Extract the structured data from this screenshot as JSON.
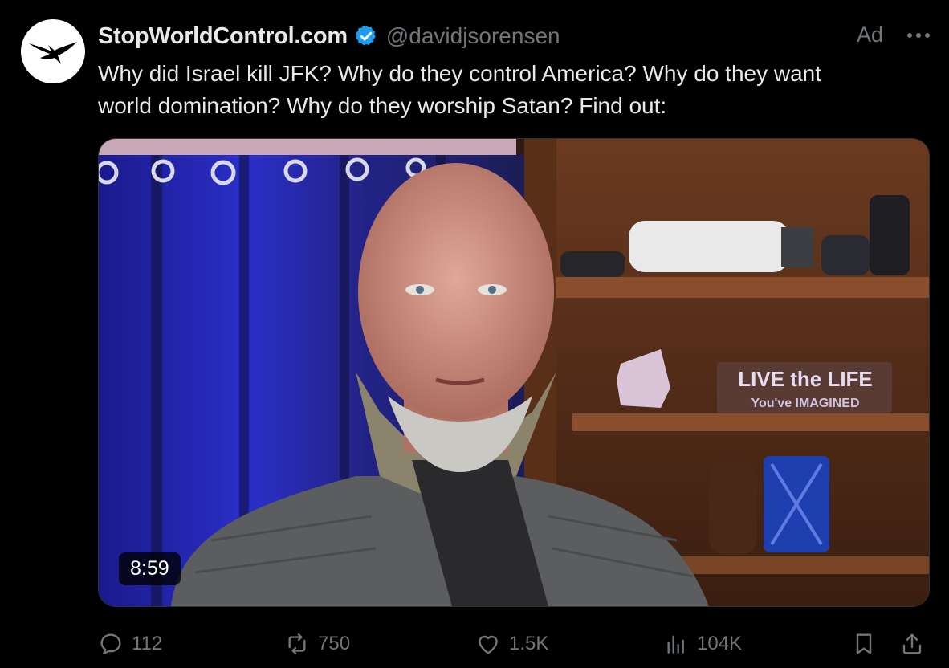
{
  "tweet": {
    "display_name": "StopWorldControl.com",
    "handle": "@davidjsorensen",
    "ad_label": "Ad",
    "text_line1": "Why did Israel kill JFK? Why do they control America? Why do they want",
    "text_line2": "world domination? Why do they worship Satan? Find out:",
    "verified_icon": "verified-badge-icon",
    "more_icon": "more-dots-icon"
  },
  "media": {
    "duration": "8:59",
    "sign_line1": "LIVE the LIFE",
    "sign_line2": "You've IMAGINED"
  },
  "actions": {
    "replies": "112",
    "reposts": "750",
    "likes": "1.5K",
    "views": "104K"
  },
  "colors": {
    "background": "#000000",
    "text": "#e7e9ea",
    "muted": "#71767b",
    "verified": "#1d9bf0"
  }
}
